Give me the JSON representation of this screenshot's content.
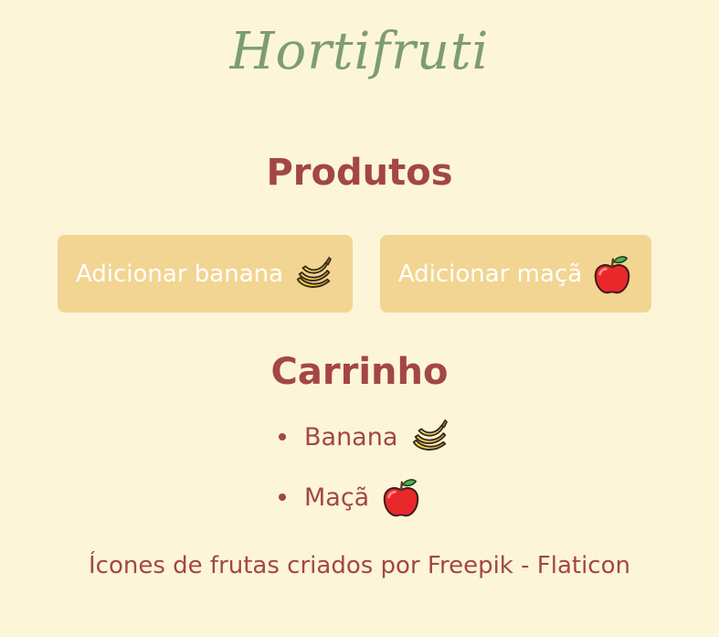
{
  "page": {
    "title": "Hortifruti",
    "background_color": "#fdf5d8",
    "title_color": "#7d9d70",
    "heading_color": "#a34646"
  },
  "produtos": {
    "heading": "Produtos",
    "buttons": [
      {
        "label": "Adicionar banana",
        "icon": "banana-icon",
        "color": "#f2d592"
      },
      {
        "label": "Adicionar maçã",
        "icon": "apple-icon",
        "color": "#f2d592"
      }
    ]
  },
  "carrinho": {
    "heading": "Carrinho",
    "items": [
      {
        "label": "Banana",
        "icon": "banana-icon"
      },
      {
        "label": "Maçã",
        "icon": "apple-icon"
      }
    ]
  },
  "footer": {
    "credit": "Ícones de frutas criados por Freepik - Flaticon"
  }
}
